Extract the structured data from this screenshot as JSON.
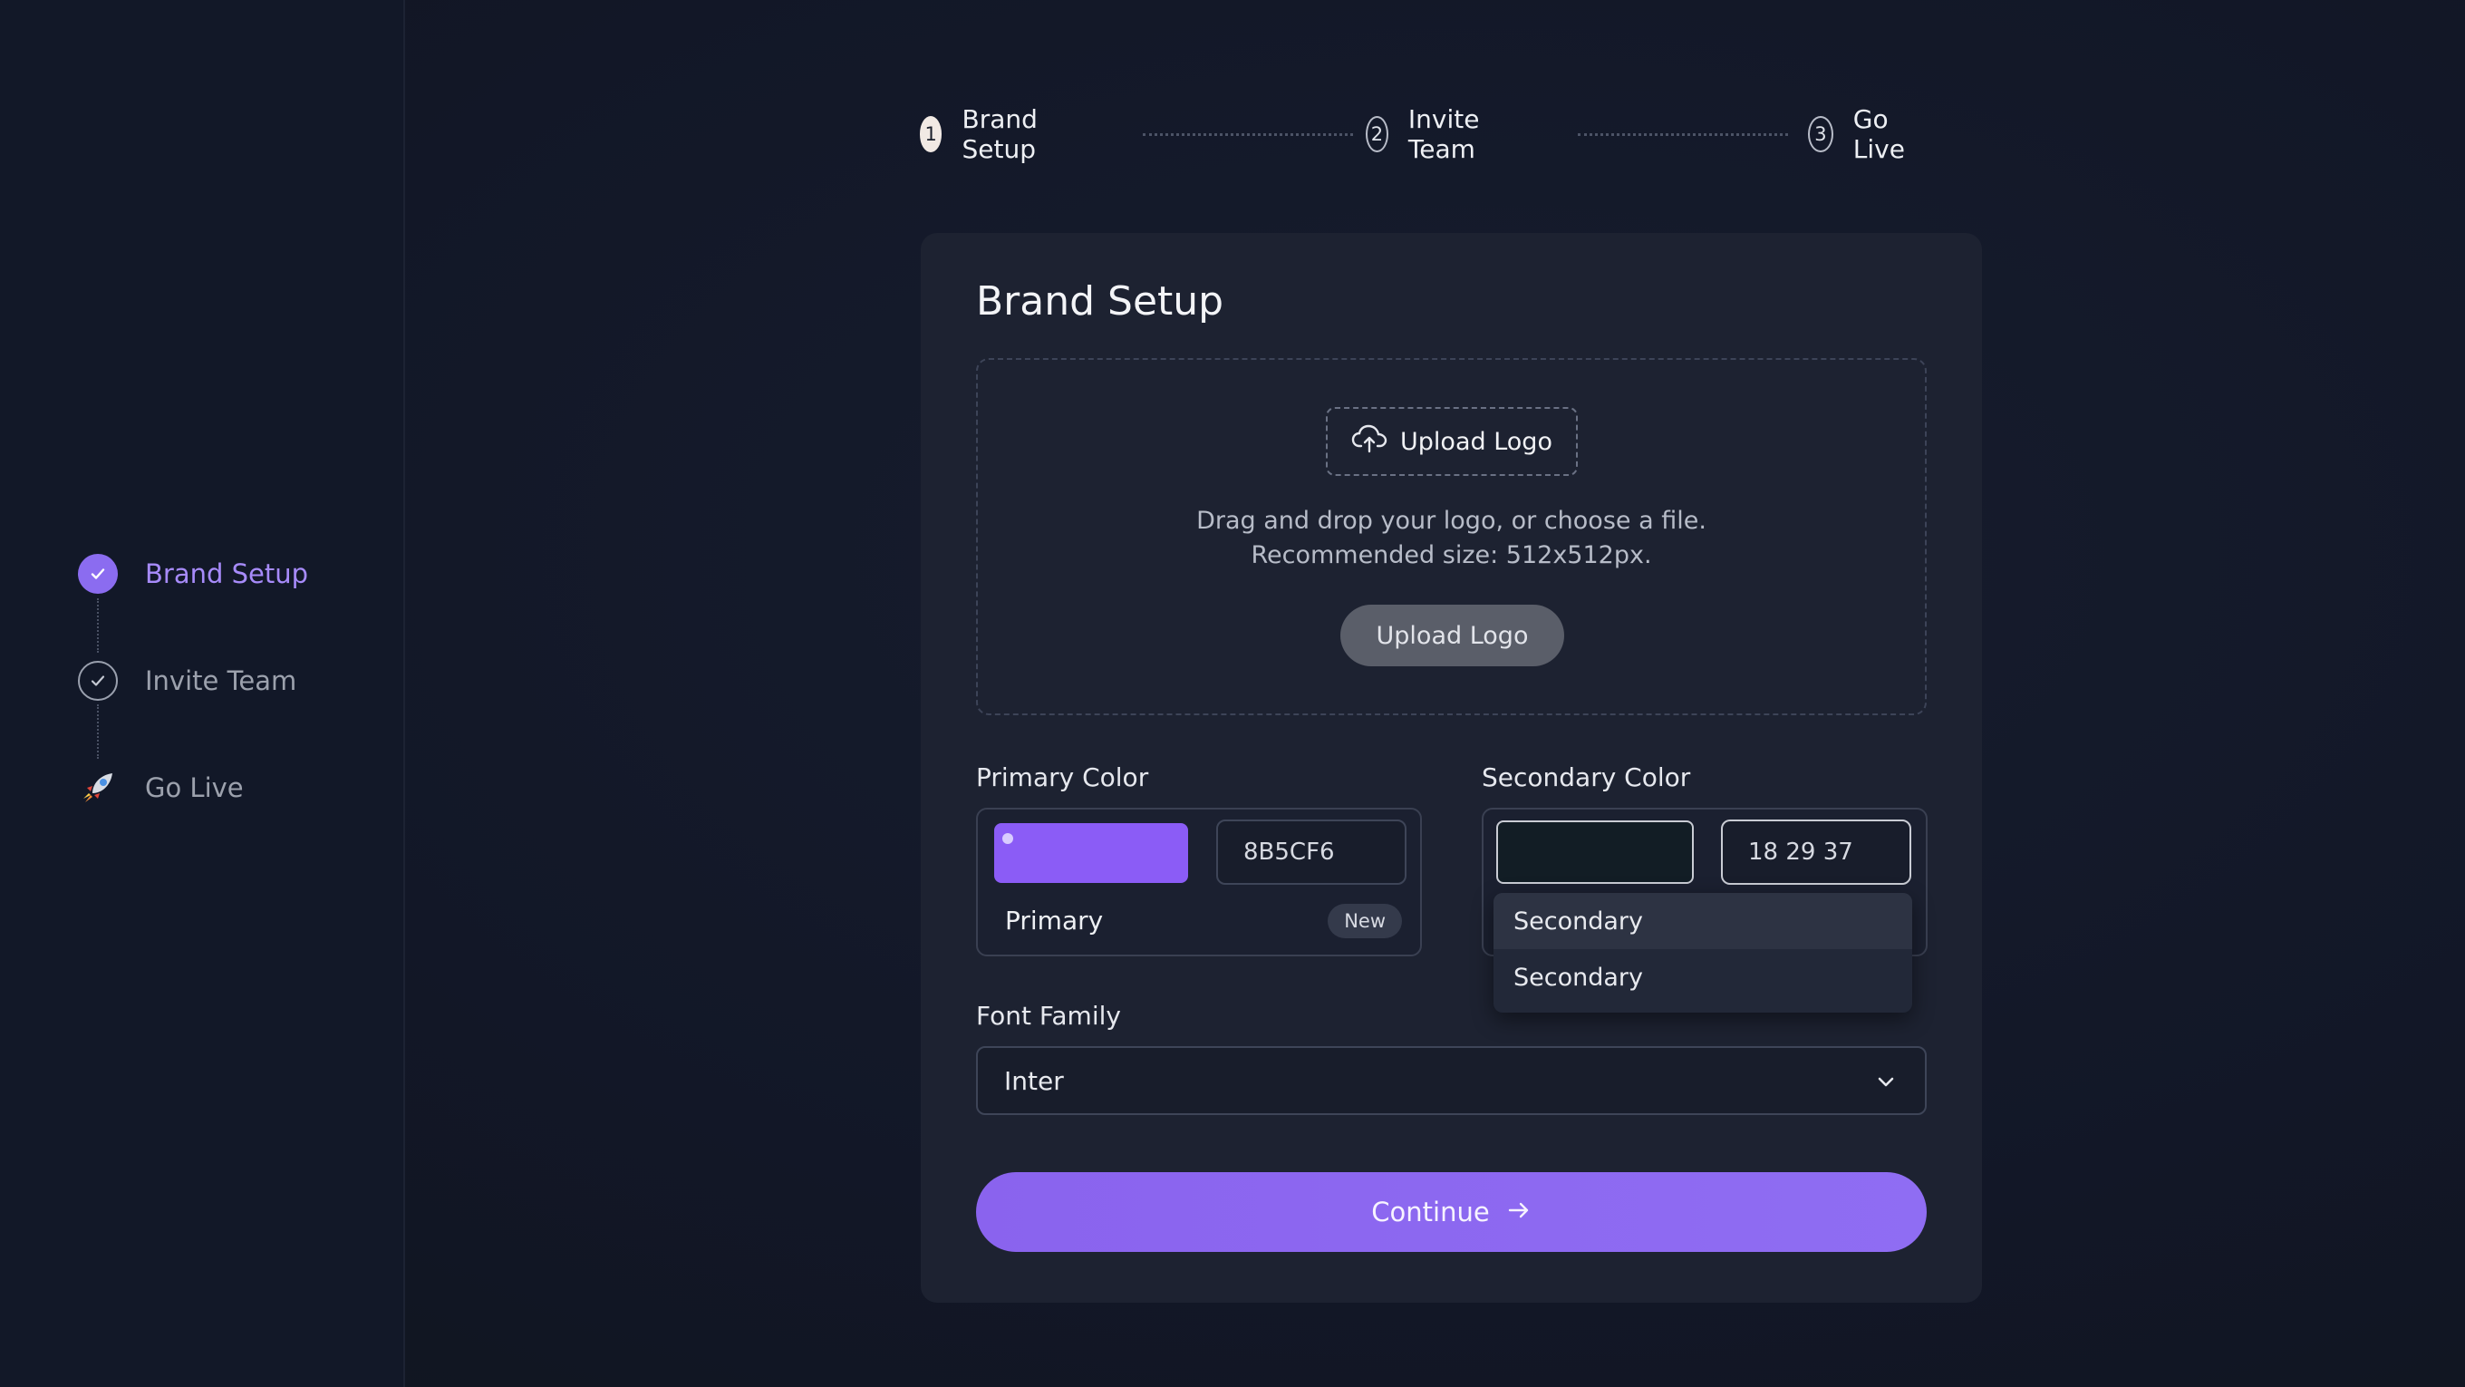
{
  "sidebar": {
    "steps": [
      {
        "label": "Brand Setup",
        "state": "done",
        "icon": "check-icon",
        "color": "#A78BFA"
      },
      {
        "label": "Invite Team",
        "state": "pending",
        "icon": "check-outline-icon"
      },
      {
        "label": "Go Live",
        "state": "pending",
        "icon": "rocket-icon"
      }
    ]
  },
  "stepper": {
    "steps": [
      {
        "number": "1",
        "label": "Brand Setup",
        "active": true
      },
      {
        "number": "2",
        "label": "Invite Team",
        "active": false
      },
      {
        "number": "3",
        "label": "Go Live",
        "active": false
      }
    ]
  },
  "card": {
    "title": "Brand Setup",
    "dropzone": {
      "chip_label": "Upload Logo",
      "hint_line1": "Drag and drop your logo, or choose a file.",
      "hint_line2": "Recommended size: 512x512px.",
      "button_label": "Upload Logo"
    },
    "primary_color": {
      "label": "Primary Color",
      "swatch": "#8B5CF6",
      "hex_value": "8B5CF6",
      "caption": "Primary",
      "tag": "New"
    },
    "secondary_color": {
      "label": "Secondary Color",
      "swatch": "#121D25",
      "rgb_value": "18 29 37",
      "dropdown_options": [
        "Secondary",
        "Secondary"
      ]
    },
    "font_family": {
      "label": "Font Family",
      "value": "Inter"
    },
    "continue_label": "Continue"
  },
  "colors": {
    "accent": "#8B5CF6",
    "background": "#121828",
    "card": "#1D2231"
  }
}
